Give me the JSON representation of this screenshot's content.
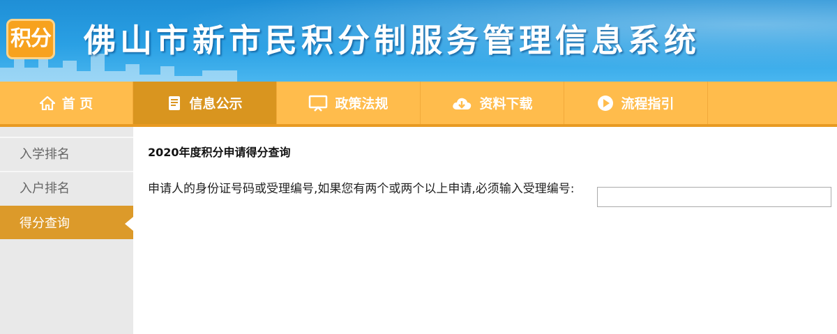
{
  "header": {
    "logo_text": "积分",
    "site_title": "佛山市新市民积分制服务管理信息系统"
  },
  "nav": {
    "items": [
      {
        "label": "首 页",
        "icon": "home-icon"
      },
      {
        "label": "信息公示",
        "icon": "document-icon",
        "active": true
      },
      {
        "label": "政策法规",
        "icon": "monitor-icon"
      },
      {
        "label": "资料下载",
        "icon": "cloud-download-icon"
      },
      {
        "label": "流程指引",
        "icon": "play-circle-icon"
      }
    ]
  },
  "sidebar": {
    "items": [
      {
        "label": "入学排名"
      },
      {
        "label": "入户排名"
      },
      {
        "label": "得分查询",
        "active": true
      }
    ]
  },
  "main": {
    "title": "2020年度积分申请得分查询",
    "query_label": "申请人的身份证号码或受理编号,如果您有两个或两个以上申请,必须输入受理编号:",
    "query_value": "",
    "query_placeholder": ""
  },
  "colors": {
    "banner_blue": "#1f8fd6",
    "nav_orange": "#ffbc4c",
    "active_orange": "#d9951f",
    "sidebar_gray": "#e9e9e9"
  }
}
